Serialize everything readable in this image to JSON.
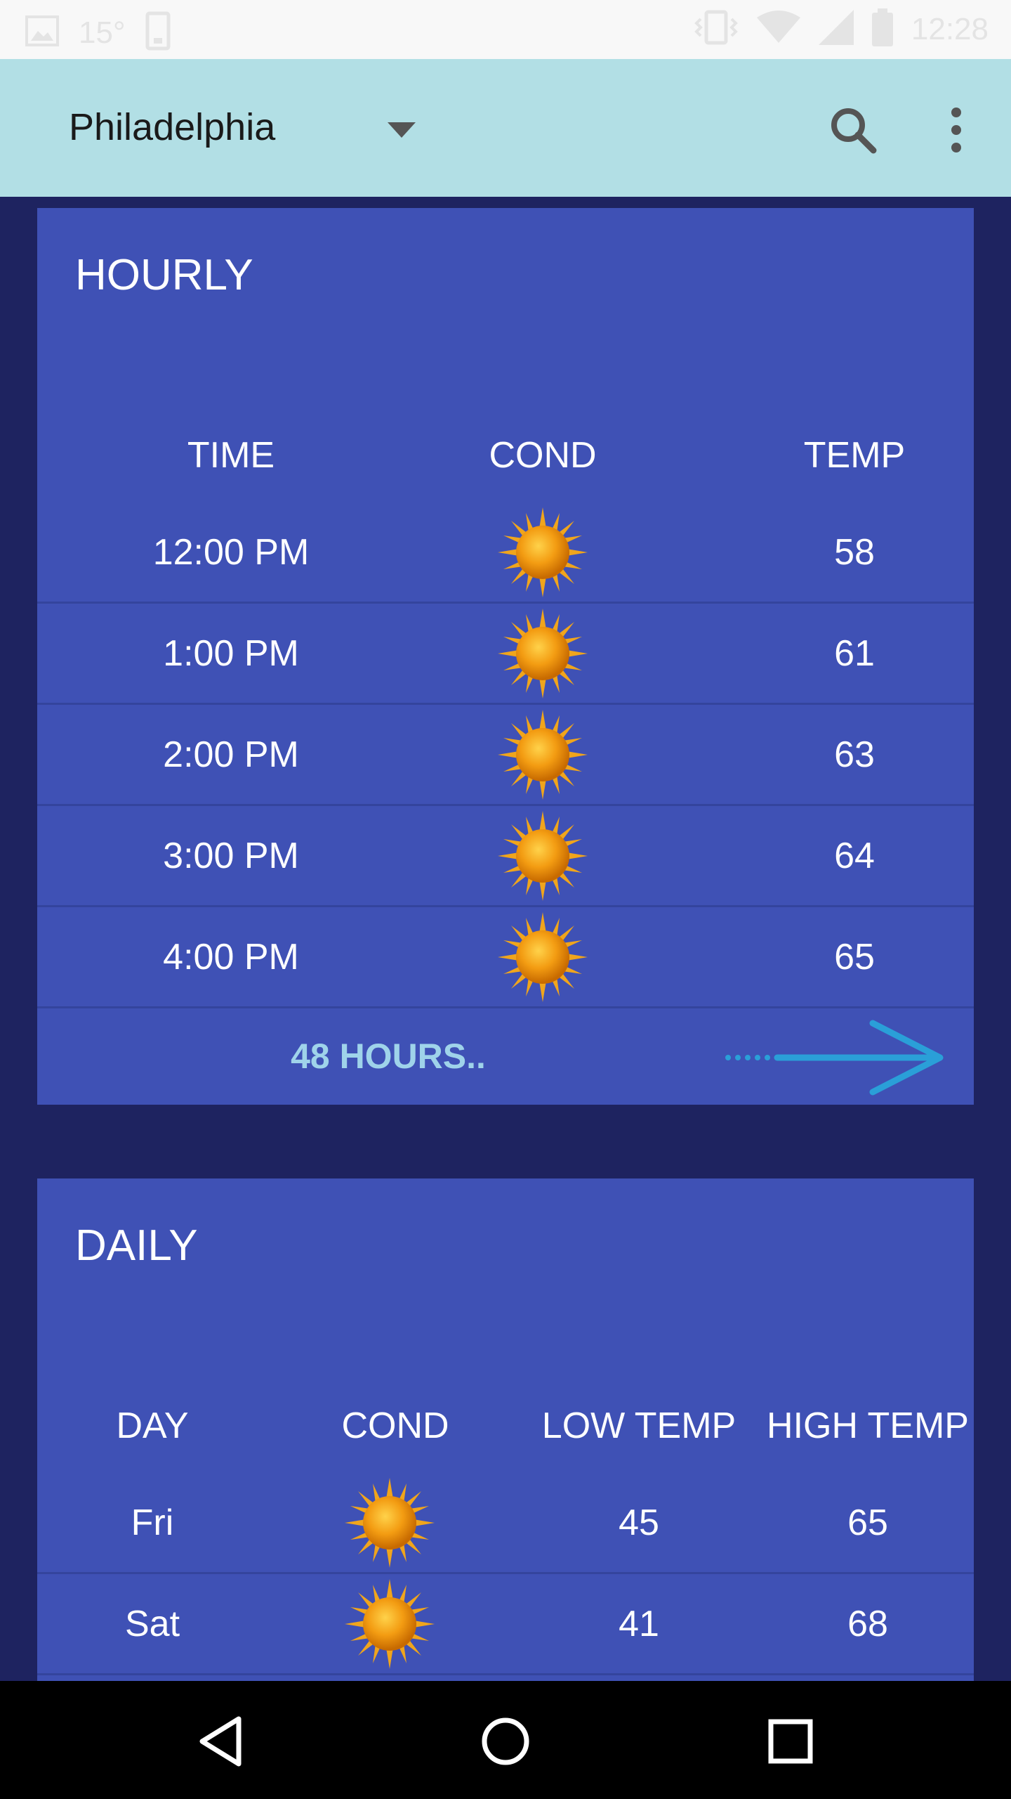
{
  "status_bar": {
    "temperature": "15°",
    "time": "12:28",
    "icons": [
      "image-icon",
      "phone-icon",
      "vibrate-icon",
      "wifi-icon",
      "signal-icon",
      "battery-icon"
    ]
  },
  "app_bar": {
    "city": "Philadelphia",
    "icons": [
      "dropdown-icon",
      "search-icon",
      "more-vert-icon"
    ]
  },
  "hourly": {
    "title": "HOURLY",
    "headers": {
      "time": "TIME",
      "cond": "COND",
      "temp": "TEMP"
    },
    "rows": [
      {
        "time": "12:00 PM",
        "cond": "sunny",
        "temp": "58"
      },
      {
        "time": "1:00 PM",
        "cond": "sunny",
        "temp": "61"
      },
      {
        "time": "2:00 PM",
        "cond": "sunny",
        "temp": "63"
      },
      {
        "time": "3:00 PM",
        "cond": "sunny",
        "temp": "64"
      },
      {
        "time": "4:00 PM",
        "cond": "sunny",
        "temp": "65"
      }
    ],
    "more_label": "48 HOURS.."
  },
  "daily": {
    "title": "DAILY",
    "headers": {
      "day": "DAY",
      "cond": "COND",
      "low": "LOW TEMP",
      "high": "HIGH TEMP"
    },
    "rows": [
      {
        "day": "Fri",
        "cond": "sunny",
        "low": "45",
        "high": "65"
      },
      {
        "day": "Sat",
        "cond": "sunny",
        "low": "41",
        "high": "68"
      }
    ]
  },
  "colors": {
    "background": "#1e2360",
    "card": "#3f51b5",
    "app_bar": "#b2dfe5",
    "link": "#9fd3ea",
    "arrow": "#2a9fd8",
    "sun": "#f0a51c"
  },
  "nav_bar": {
    "icons": [
      "back-icon",
      "home-icon",
      "recents-icon"
    ]
  }
}
